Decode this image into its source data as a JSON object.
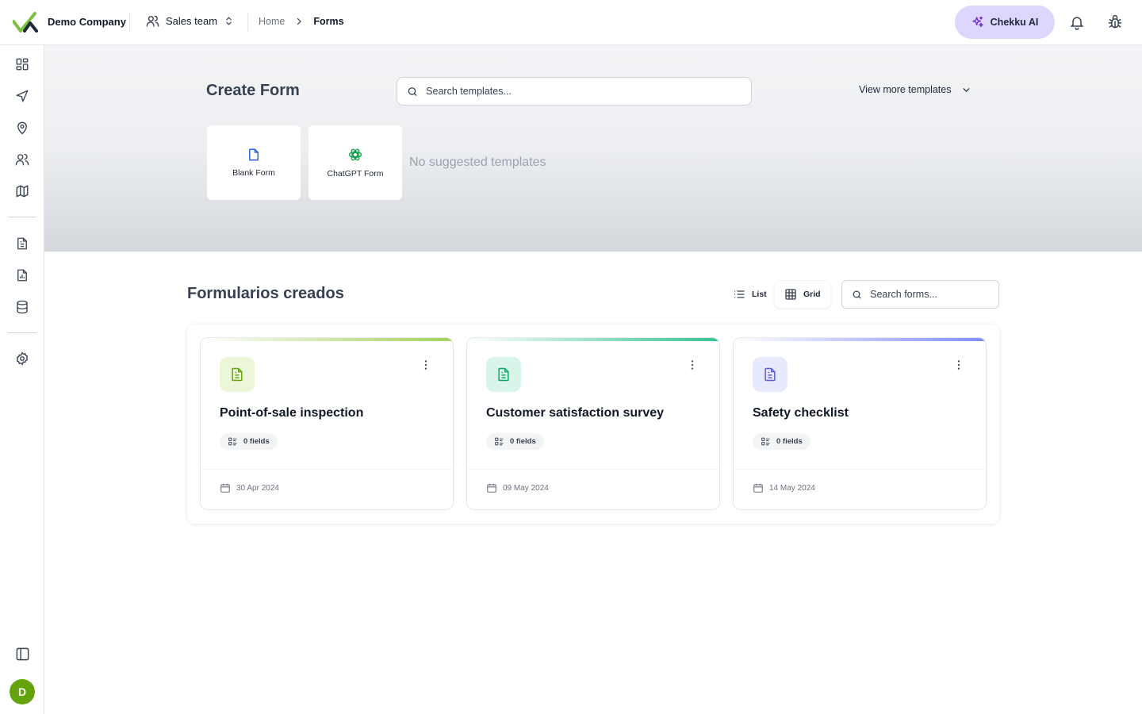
{
  "header": {
    "company": "Demo Company",
    "team": "Sales team",
    "breadcrumb": {
      "home": "Home",
      "current": "Forms"
    },
    "ai_button": "Chekku AI"
  },
  "hero": {
    "title": "Create Form",
    "search_placeholder": "Search templates...",
    "view_more": "View more templates",
    "templates": [
      {
        "label": "Blank Form",
        "icon": "file-icon"
      },
      {
        "label": "ChatGPT Form",
        "icon": "openai-icon"
      }
    ],
    "empty_message": "No suggested templates"
  },
  "forms": {
    "title": "Formularios creados",
    "list_label": "List",
    "grid_label": "Grid",
    "active_view": "Grid",
    "search_placeholder": "Search forms...",
    "items": [
      {
        "title": "Point-of-sale inspection",
        "fields": "0 fields",
        "date": "30 Apr 2024",
        "accent": "#a3d05a",
        "icon_bg": "#ecf7d9",
        "icon_color": "#65a30d"
      },
      {
        "title": "Customer satisfaction survey",
        "fields": "0 fields",
        "date": "09 May 2024",
        "accent": "#34c38f",
        "icon_bg": "#d9f5ea",
        "icon_color": "#10a36b"
      },
      {
        "title": "Safety checklist",
        "fields": "0 fields",
        "date": "14 May 2024",
        "accent": "#818cf8",
        "icon_bg": "#e7e9fd",
        "icon_color": "#5b5fd6"
      }
    ]
  },
  "sidebar": {
    "items": [
      "dashboard-icon",
      "send-icon",
      "map-pin-icon",
      "users-icon",
      "map-icon",
      "forms-icon",
      "reports-icon",
      "database-icon",
      "settings-icon",
      "sidebar-toggle-icon"
    ],
    "avatar_initial": "D"
  },
  "colors": {
    "brand_green": "#65a30d",
    "ai_purple": "#ddd6fe"
  }
}
